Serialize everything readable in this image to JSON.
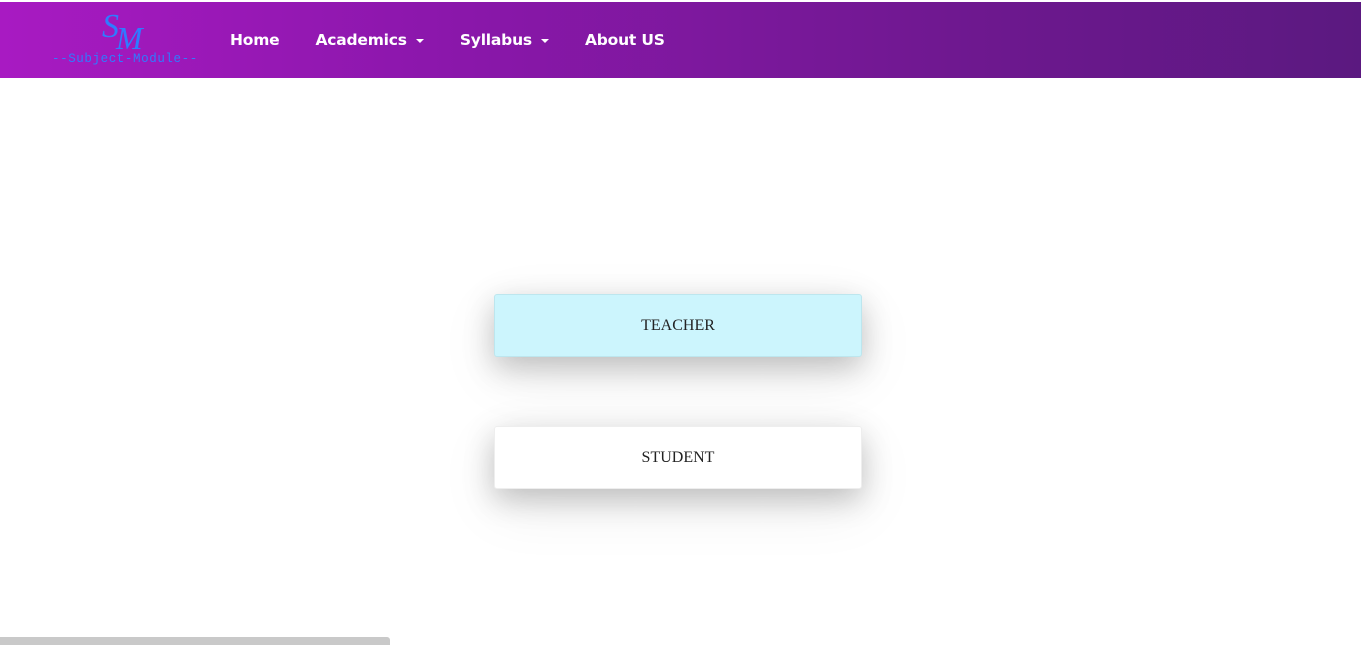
{
  "brand": {
    "monogram_s": "S",
    "monogram_m": "M",
    "subtitle": "--Subject-Module--"
  },
  "nav": {
    "items": [
      {
        "label": "Home",
        "dropdown": false
      },
      {
        "label": "Academics",
        "dropdown": true
      },
      {
        "label": "Syllabus",
        "dropdown": true
      },
      {
        "label": "About US",
        "dropdown": false
      }
    ]
  },
  "roles": {
    "teacher": "TEACHER",
    "student": "STUDENT"
  },
  "colors": {
    "navbar_gradient_start": "#a81ac2",
    "navbar_gradient_end": "#5b1980",
    "brand_blue": "#2f7bff",
    "teacher_bg": "#ccf5fd",
    "student_bg": "#ffffff"
  }
}
